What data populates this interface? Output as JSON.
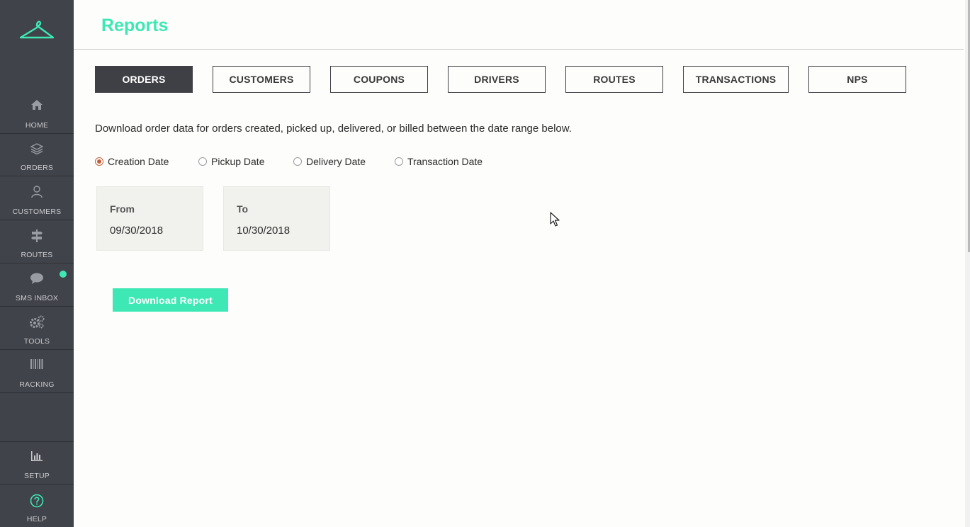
{
  "header": {
    "title": "Reports"
  },
  "sidebar": {
    "items": [
      {
        "label": "HOME",
        "icon": "home-icon"
      },
      {
        "label": "ORDERS",
        "icon": "layers-icon"
      },
      {
        "label": "CUSTOMERS",
        "icon": "user-icon"
      },
      {
        "label": "ROUTES",
        "icon": "signpost-icon"
      },
      {
        "label": "SMS INBOX",
        "icon": "chat-bubble-icon"
      },
      {
        "label": "TOOLS",
        "icon": "gears-icon"
      },
      {
        "label": "RACKING",
        "icon": "barcode-icon"
      },
      {
        "label": "SETUP",
        "icon": "bar-chart-icon"
      },
      {
        "label": "HELP",
        "icon": "question-circle-icon"
      }
    ]
  },
  "tabs": [
    {
      "label": "ORDERS",
      "active": true
    },
    {
      "label": "CUSTOMERS",
      "active": false
    },
    {
      "label": "COUPONS",
      "active": false
    },
    {
      "label": "DRIVERS",
      "active": false
    },
    {
      "label": "ROUTES",
      "active": false
    },
    {
      "label": "TRANSACTIONS",
      "active": false
    },
    {
      "label": "NPS",
      "active": false
    }
  ],
  "description": "Download order data for orders created, picked up, delivered, or billed between the date range below.",
  "date_types": [
    {
      "label": "Creation Date",
      "checked": true
    },
    {
      "label": "Pickup Date",
      "checked": false
    },
    {
      "label": "Delivery Date",
      "checked": false
    },
    {
      "label": "Transaction Date",
      "checked": false
    }
  ],
  "range": {
    "from_label": "From",
    "from_value": "09/30/2018",
    "to_label": "To",
    "to_value": "10/30/2018"
  },
  "download_label": "Download Report",
  "colors": {
    "accent": "#3de8b4",
    "sidebar": "#41434a",
    "radio_checked": "#c0603a"
  }
}
